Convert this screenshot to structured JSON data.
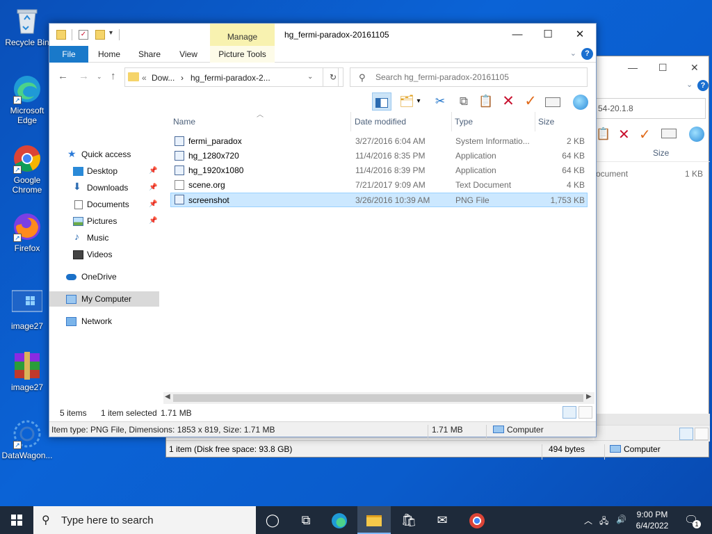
{
  "desktop": {
    "icons": [
      {
        "label": "Recycle Bin"
      },
      {
        "label": "Microsoft Edge"
      },
      {
        "label": "Google Chrome"
      },
      {
        "label": "Firefox"
      },
      {
        "label": "image27"
      },
      {
        "label": "image27"
      },
      {
        "label": "DataWagon..."
      }
    ]
  },
  "bg_window": {
    "address_fragment": "54-20.1.8",
    "col_size": "Size",
    "row_type_fragment": "ocument",
    "row_size": "1 KB",
    "status_items": "1 item (Disk free space: 93.8 GB)",
    "status_bytes": "494 bytes",
    "status_location": "Computer"
  },
  "window": {
    "title": "hg_fermi-paradox-20161105",
    "context_tab_group": "Manage",
    "tabs": [
      "File",
      "Home",
      "Share",
      "View",
      "Picture Tools"
    ],
    "address": {
      "prefix": "«",
      "seg1": "Dow...",
      "sep": "›",
      "seg2": "hg_fermi-paradox-2..."
    },
    "search": {
      "placeholder": "Search hg_fermi-paradox-20161105"
    },
    "nav": {
      "quick_access": "Quick access",
      "items": [
        {
          "label": "Desktop",
          "pinned": true
        },
        {
          "label": "Downloads",
          "pinned": true
        },
        {
          "label": "Documents",
          "pinned": true
        },
        {
          "label": "Pictures",
          "pinned": true
        },
        {
          "label": "Music",
          "pinned": false
        },
        {
          "label": "Videos",
          "pinned": false
        }
      ],
      "onedrive": "OneDrive",
      "computer": "My Computer",
      "network": "Network"
    },
    "columns": {
      "name": "Name",
      "date": "Date modified",
      "type": "Type",
      "size": "Size"
    },
    "files": [
      {
        "name": "fermi_paradox",
        "date": "3/27/2016 6:04 AM",
        "type": "System Informatio...",
        "size": "2 KB"
      },
      {
        "name": "hg_1280x720",
        "date": "11/4/2016 8:35 PM",
        "type": "Application",
        "size": "64 KB"
      },
      {
        "name": "hg_1920x1080",
        "date": "11/4/2016 8:39 PM",
        "type": "Application",
        "size": "64 KB"
      },
      {
        "name": "scene.org",
        "date": "7/21/2017 9:09 AM",
        "type": "Text Document",
        "size": "4 KB"
      },
      {
        "name": "screenshot",
        "date": "3/26/2016 10:39 AM",
        "type": "PNG File",
        "size": "1,753 KB"
      }
    ],
    "status": {
      "count": "5 items",
      "selected": "1 item selected",
      "selected_size": "1.71 MB"
    },
    "details": {
      "info": "Item type: PNG File, Dimensions: 1853 x 819, Size: 1.71 MB",
      "size": "1.71 MB",
      "location": "Computer"
    }
  },
  "taskbar": {
    "search_placeholder": "Type here to search",
    "time": "9:00 PM",
    "date": "6/4/2022",
    "notification_count": "1"
  },
  "colors": {
    "accent": "#1979ca",
    "selection": "#cce8ff",
    "manage_tab": "#f8f2b0"
  }
}
